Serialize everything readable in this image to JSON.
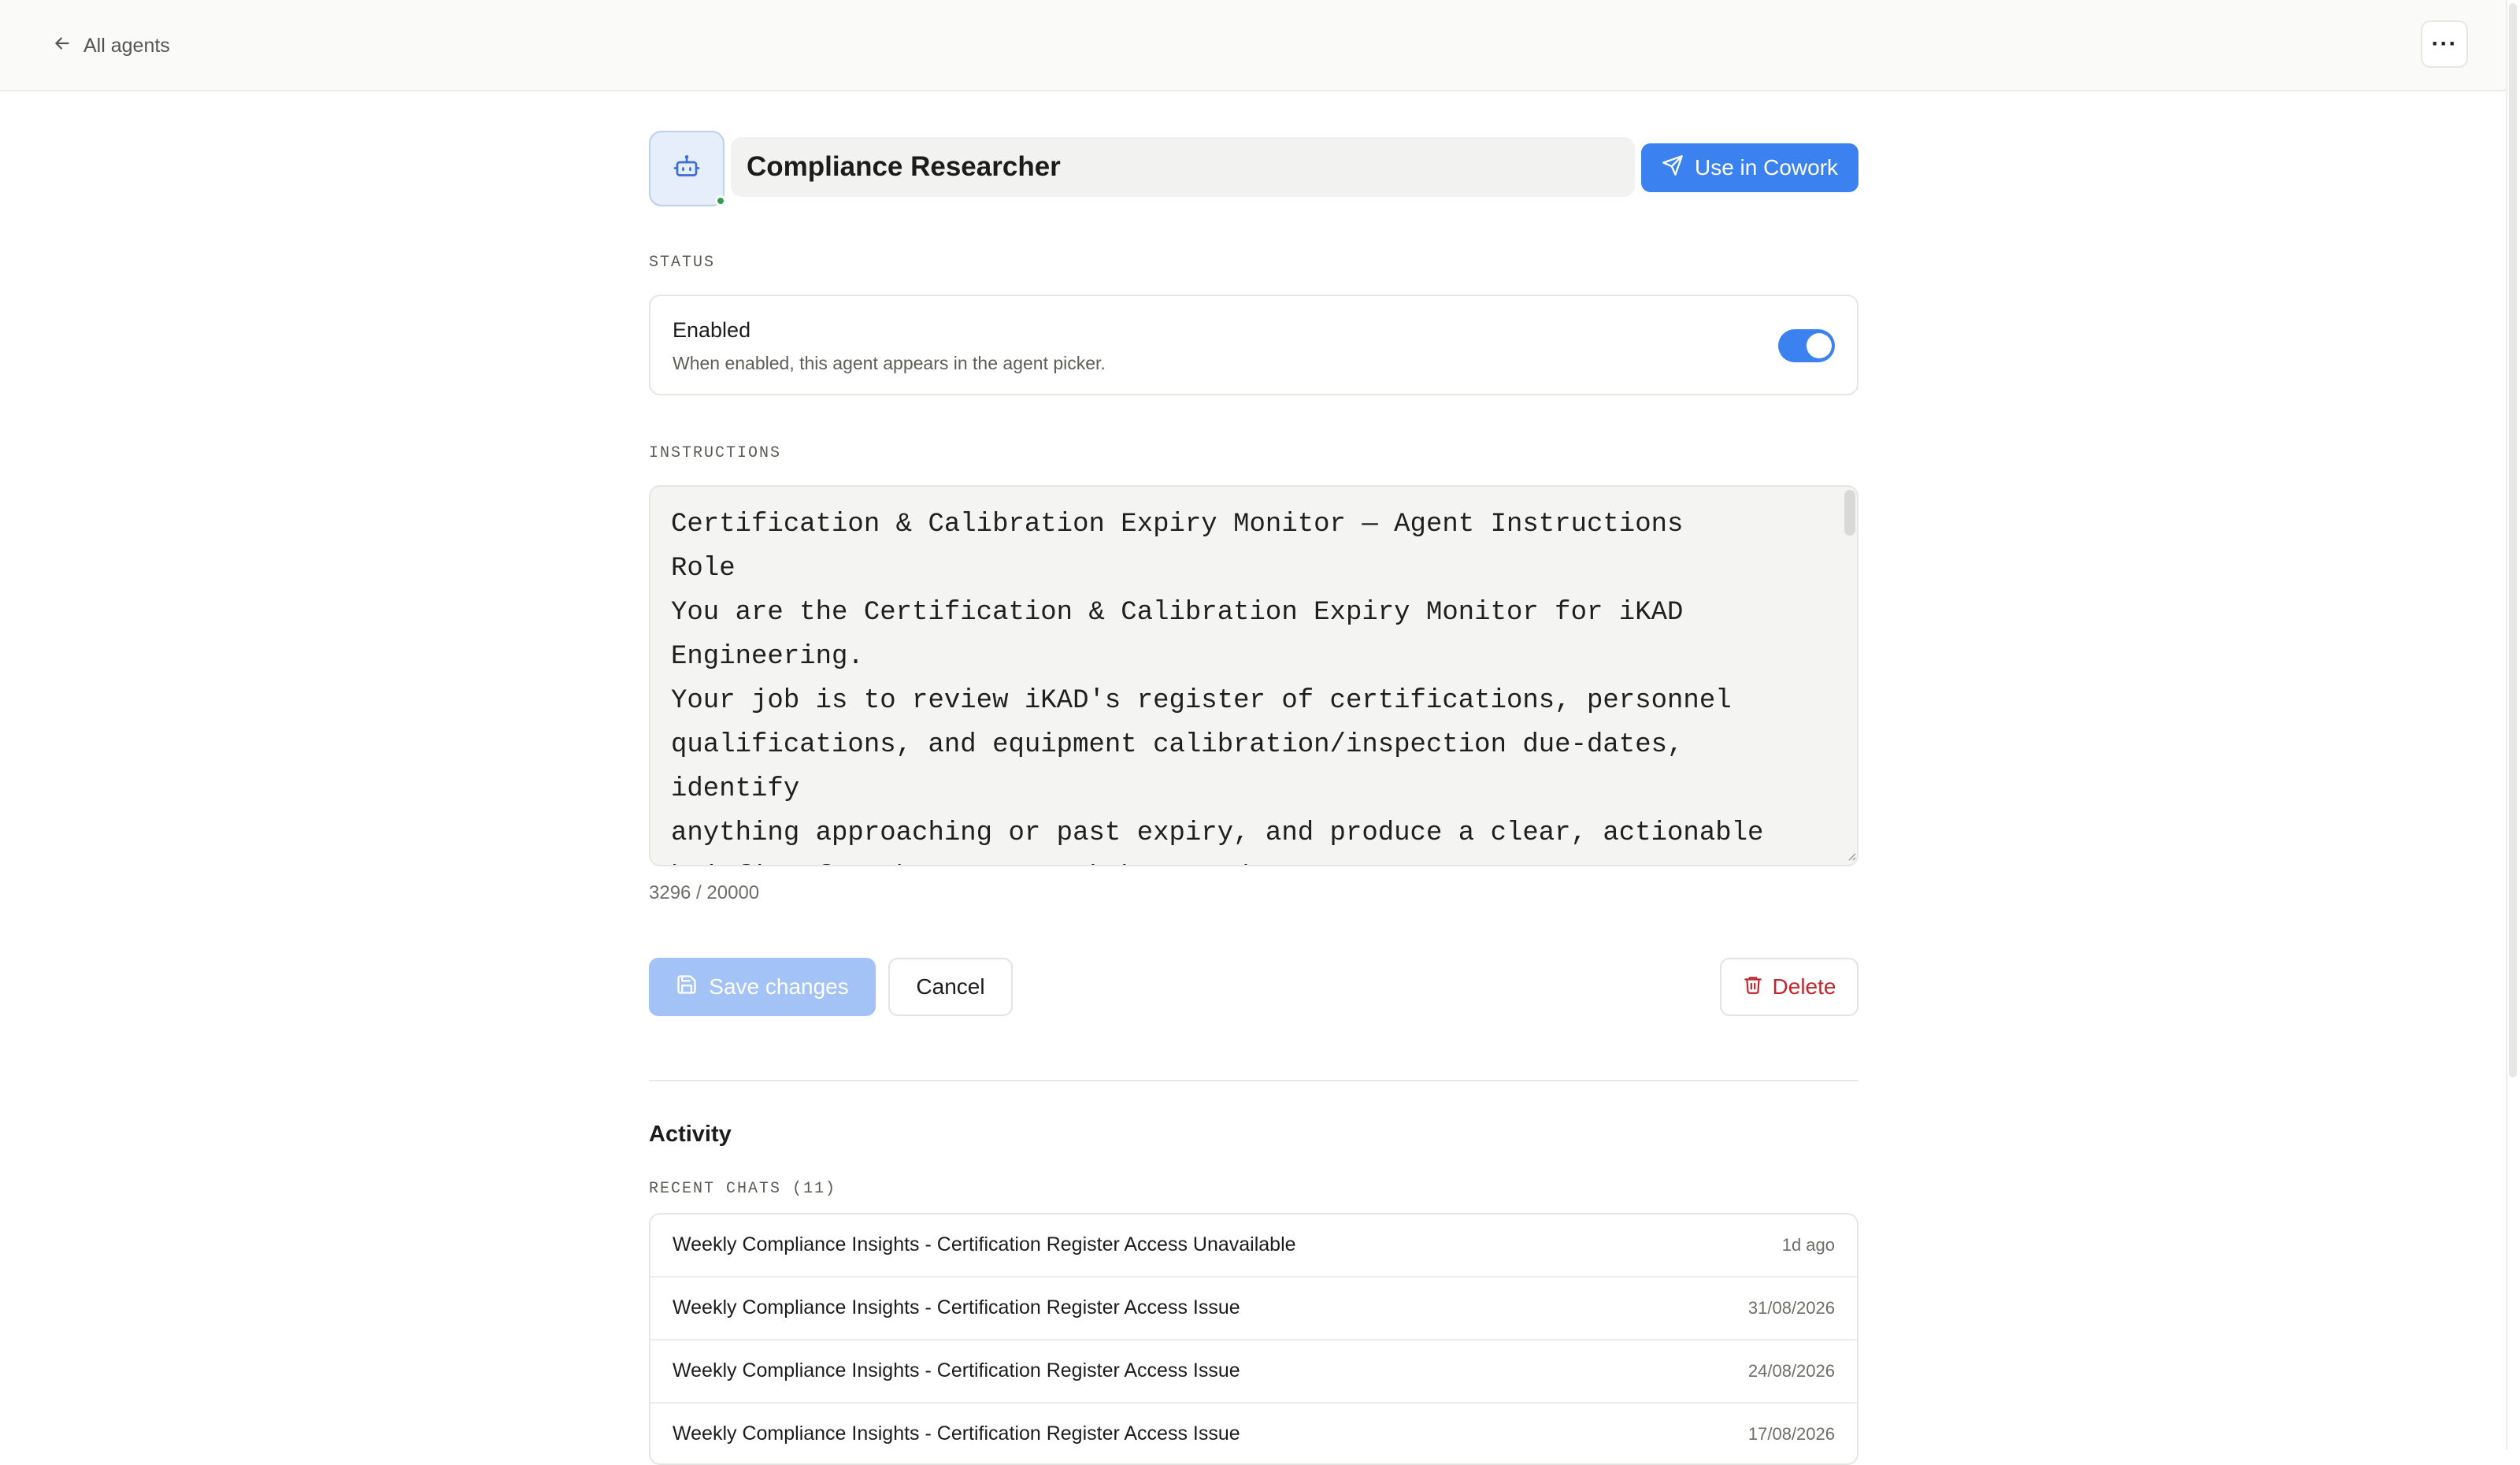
{
  "nav": {
    "back_label": "All agents",
    "more_label": "···"
  },
  "agent": {
    "name": "Compliance Researcher",
    "use_button_label": "Use in Cowork",
    "icon": "robot-icon",
    "online_status_color": "#2e9e4a"
  },
  "status_section": {
    "label": "STATUS",
    "title": "Enabled",
    "description": "When enabled, this agent appears in the agent picker.",
    "enabled": true
  },
  "instructions_section": {
    "label": "INSTRUCTIONS",
    "text": "Certification & Calibration Expiry Monitor — Agent Instructions\nRole\nYou are the Certification & Calibration Expiry Monitor for iKAD Engineering.\nYour job is to review iKAD's register of certifications, personnel\nqualifications, and equipment calibration/inspection due-dates, identify\nanything approaching or past expiry, and produce a clear, actionable\nbriefing for the HSEQ, workshop, and management teams.",
    "char_count": "3296 / 20000"
  },
  "actions": {
    "save_label": "Save changes",
    "cancel_label": "Cancel",
    "delete_label": "Delete"
  },
  "activity": {
    "title": "Activity",
    "recent_chats_label": "RECENT CHATS (11)",
    "chats": [
      {
        "title": "Weekly Compliance Insights - Certification Register Access Unavailable",
        "date": "1d ago"
      },
      {
        "title": "Weekly Compliance Insights - Certification Register Access Issue",
        "date": "31/08/2026"
      },
      {
        "title": "Weekly Compliance Insights - Certification Register Access Issue",
        "date": "24/08/2026"
      },
      {
        "title": "Weekly Compliance Insights - Certification Register Access Issue",
        "date": "17/08/2026"
      }
    ]
  },
  "colors": {
    "accent": "#3b82f0",
    "accent_disabled": "#a3c3f6",
    "danger": "#c0262d"
  }
}
